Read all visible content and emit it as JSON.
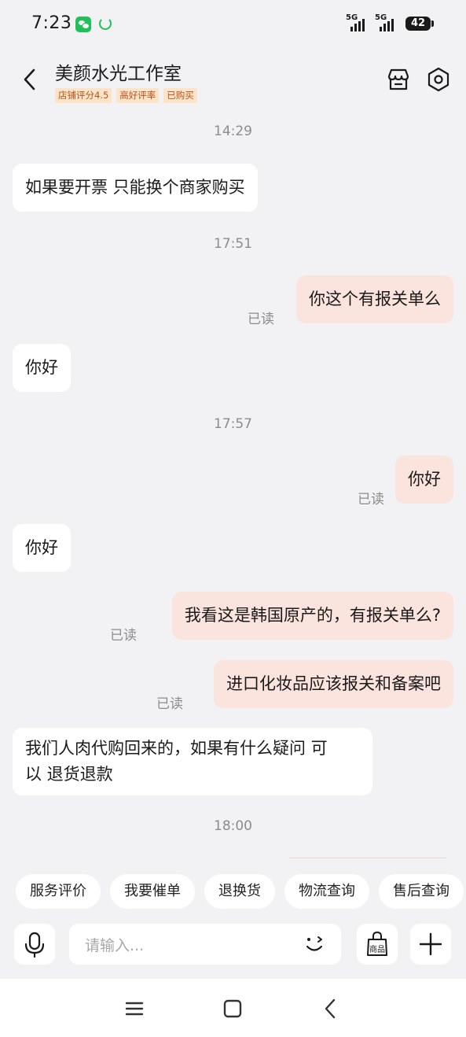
{
  "status_bar": {
    "time": "7:23",
    "signal1_label": "5G",
    "signal2_label": "5G",
    "battery": "42"
  },
  "header": {
    "title": "美颜水光工作室",
    "tags": [
      "店铺评分4.5",
      "高好评率",
      "已购买"
    ]
  },
  "chat": {
    "read_label": "已读",
    "timestamps": [
      "14:29",
      "17:51",
      "17:57",
      "18:00"
    ],
    "messages": [
      {
        "side": "in",
        "text": "如果要开票 只能换个商家购买"
      },
      {
        "side": "out",
        "text": "你这个有报关单么"
      },
      {
        "side": "in",
        "text": "你好"
      },
      {
        "side": "out",
        "text": "你好"
      },
      {
        "side": "in",
        "text": "你好"
      },
      {
        "side": "out",
        "text": "我看这是韩国原产的，有报关单么?"
      },
      {
        "side": "out",
        "text": "进口化妆品应该报关和备案吧"
      },
      {
        "side": "in",
        "text_line1": "我们人肉代购回来的，如果有什么疑问 可",
        "text_line2": "以 退货退款"
      }
    ]
  },
  "quick_actions": [
    "服务评价",
    "我要催单",
    "退换货",
    "物流查询",
    "售后查询"
  ],
  "input_bar": {
    "placeholder": "请输入...",
    "goods_label": "商品"
  },
  "icons": {
    "back": "back-chevron-icon",
    "store": "store-icon",
    "settings": "settings-icon",
    "mic": "microphone-icon",
    "emoji": "emoji-icon",
    "goods": "shopping-bag-icon",
    "plus": "plus-icon",
    "nav_menu": "menu-icon",
    "nav_home": "home-icon",
    "nav_back": "back-icon"
  },
  "colors": {
    "background": "#f2f2f4",
    "bubble_out": "#fbe4dd",
    "bubble_in": "#ffffff",
    "tag_bg": "#fde3c8",
    "tag_text": "#b3541e",
    "wechat_green": "#1fc25a"
  }
}
